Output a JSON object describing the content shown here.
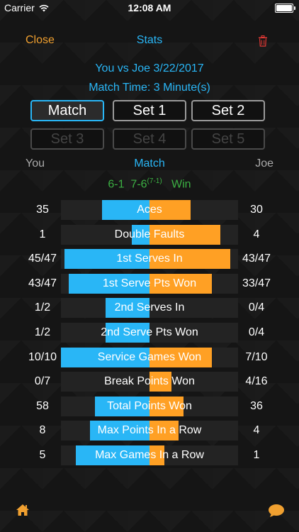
{
  "status": {
    "carrier": "Carrier",
    "time": "12:08 AM"
  },
  "nav": {
    "close": "Close",
    "title": "Stats"
  },
  "info": {
    "line1": "You vs Joe 3/22/2017",
    "line2": "Match Time: 3 Minute(s)"
  },
  "sets": [
    {
      "label": "Match",
      "state": "selected"
    },
    {
      "label": "Set 1",
      "state": "normal"
    },
    {
      "label": "Set 2",
      "state": "normal"
    },
    {
      "label": "Set 3",
      "state": "disabled"
    },
    {
      "label": "Set 4",
      "state": "disabled"
    },
    {
      "label": "Set 5",
      "state": "disabled"
    }
  ],
  "players": {
    "left": "You",
    "center": "Match",
    "right": "Joe"
  },
  "score": {
    "set1": "6-1",
    "set2": "7-6",
    "tiebreak": "(7-1)",
    "result": "Win"
  },
  "colors": {
    "accent_blue": "#29b6f6",
    "accent_orange": "#ffa024",
    "win_green": "#3cb043",
    "close_orange": "#f0a030",
    "trash_red": "#e53935"
  },
  "stats": [
    {
      "label": "Aces",
      "left": "35",
      "right": "30",
      "left_frac": 0.54,
      "right_frac": 0.46
    },
    {
      "label": "Double Faults",
      "left": "1",
      "right": "4",
      "left_frac": 0.2,
      "right_frac": 0.8
    },
    {
      "label": "1st Serves In",
      "left": "45/47",
      "right": "43/47",
      "left_frac": 0.96,
      "right_frac": 0.91
    },
    {
      "label": "1st Serve Pts Won",
      "left": "43/47",
      "right": "33/47",
      "left_frac": 0.91,
      "right_frac": 0.7
    },
    {
      "label": "2nd Serves In",
      "left": "1/2",
      "right": "0/4",
      "left_frac": 0.5,
      "right_frac": 0.0
    },
    {
      "label": "2nd Serve Pts Won",
      "left": "1/2",
      "right": "0/4",
      "left_frac": 0.5,
      "right_frac": 0.0
    },
    {
      "label": "Service Games Won",
      "left": "10/10",
      "right": "7/10",
      "left_frac": 1.0,
      "right_frac": 0.7
    },
    {
      "label": "Break Points Won",
      "left": "0/7",
      "right": "4/16",
      "left_frac": 0.0,
      "right_frac": 0.25
    },
    {
      "label": "Total Points Won",
      "left": "58",
      "right": "36",
      "left_frac": 0.62,
      "right_frac": 0.38
    },
    {
      "label": "Max Points In a Row",
      "left": "8",
      "right": "4",
      "left_frac": 0.67,
      "right_frac": 0.33
    },
    {
      "label": "Max Games In a Row",
      "left": "5",
      "right": "1",
      "left_frac": 0.83,
      "right_frac": 0.17
    }
  ],
  "icons": {
    "home": "home-icon",
    "chat": "chat-bubble-icon",
    "trash": "trash-icon",
    "wifi": "wifi-icon",
    "battery": "battery-icon"
  }
}
